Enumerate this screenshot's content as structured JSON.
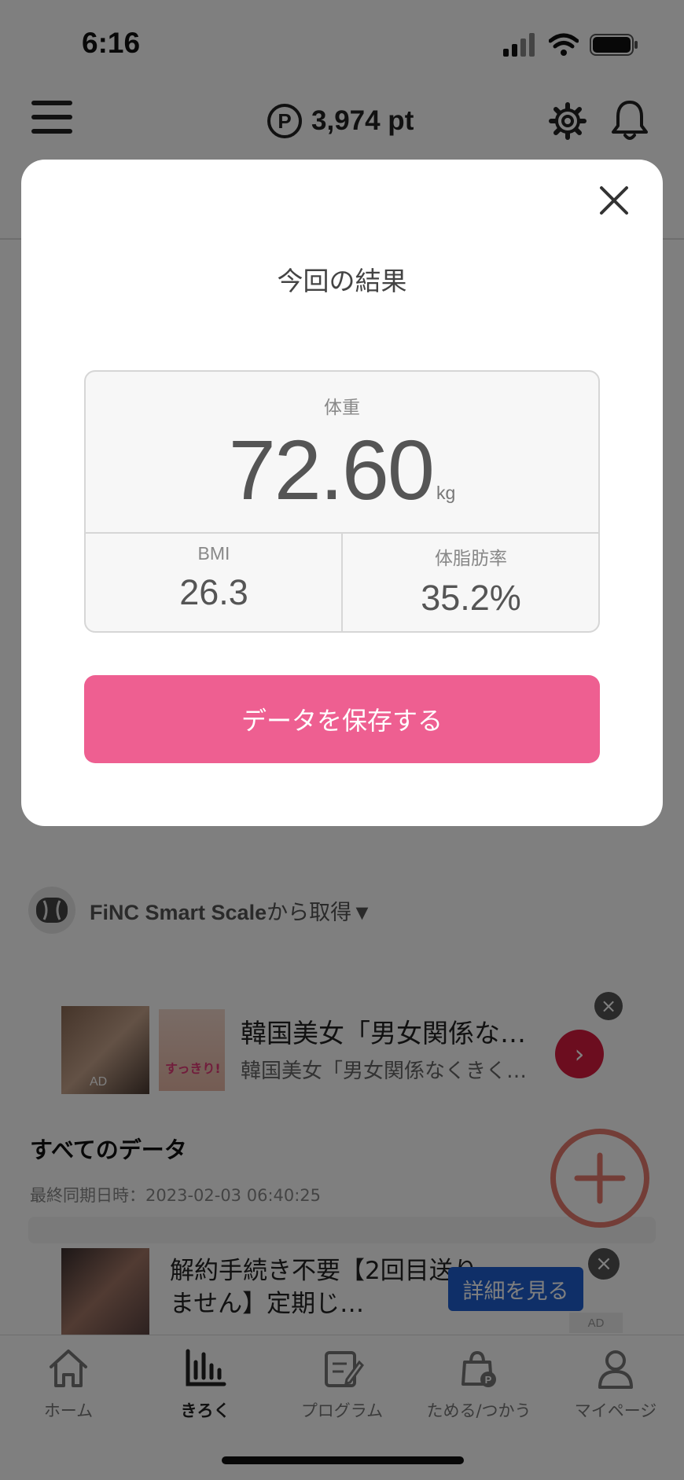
{
  "status_bar": {
    "time": "6:16"
  },
  "header": {
    "points": "3,974 pt",
    "points_icon_letter": "P"
  },
  "source": {
    "device": "FiNC Smart Scale",
    "suffix": "から取得▼"
  },
  "ad_top": {
    "title": "韓国美女「男女関係な…",
    "subtitle": "韓国美女「男女関係なくきく…",
    "ad_mark": "AD",
    "thumb_text": "すっきり!"
  },
  "all_data": {
    "title": "すべてのデータ",
    "last_sync": "最終同期日時：2023-02-03 06:40:25"
  },
  "ad_bottom": {
    "text": "解約手続き不要【2回目送りません】定期じ…",
    "cta": "詳細を見る",
    "ad_mark": "AD"
  },
  "bottom_nav": [
    {
      "label": "ホーム",
      "icon": "home-icon"
    },
    {
      "label": "きろく",
      "icon": "chart-icon",
      "active": true
    },
    {
      "label": "プログラム",
      "icon": "program-icon"
    },
    {
      "label": "ためる/つかう",
      "icon": "points-bag-icon"
    },
    {
      "label": "マイページ",
      "icon": "person-icon"
    }
  ],
  "modal": {
    "title": "今回の結果",
    "weight_label": "体重",
    "weight_value": "72.60",
    "weight_unit": "kg",
    "bmi_label": "BMI",
    "bmi_value": "26.3",
    "body_fat_label": "体脂肪率",
    "body_fat_value": "35.2%",
    "save_button": "データを保存する"
  },
  "colors": {
    "accent_pink": "#ee5f91",
    "fab_ring": "#e67a6e",
    "ad_cta_blue": "#1f5fd1",
    "ad_go_red": "#d81b3f"
  }
}
